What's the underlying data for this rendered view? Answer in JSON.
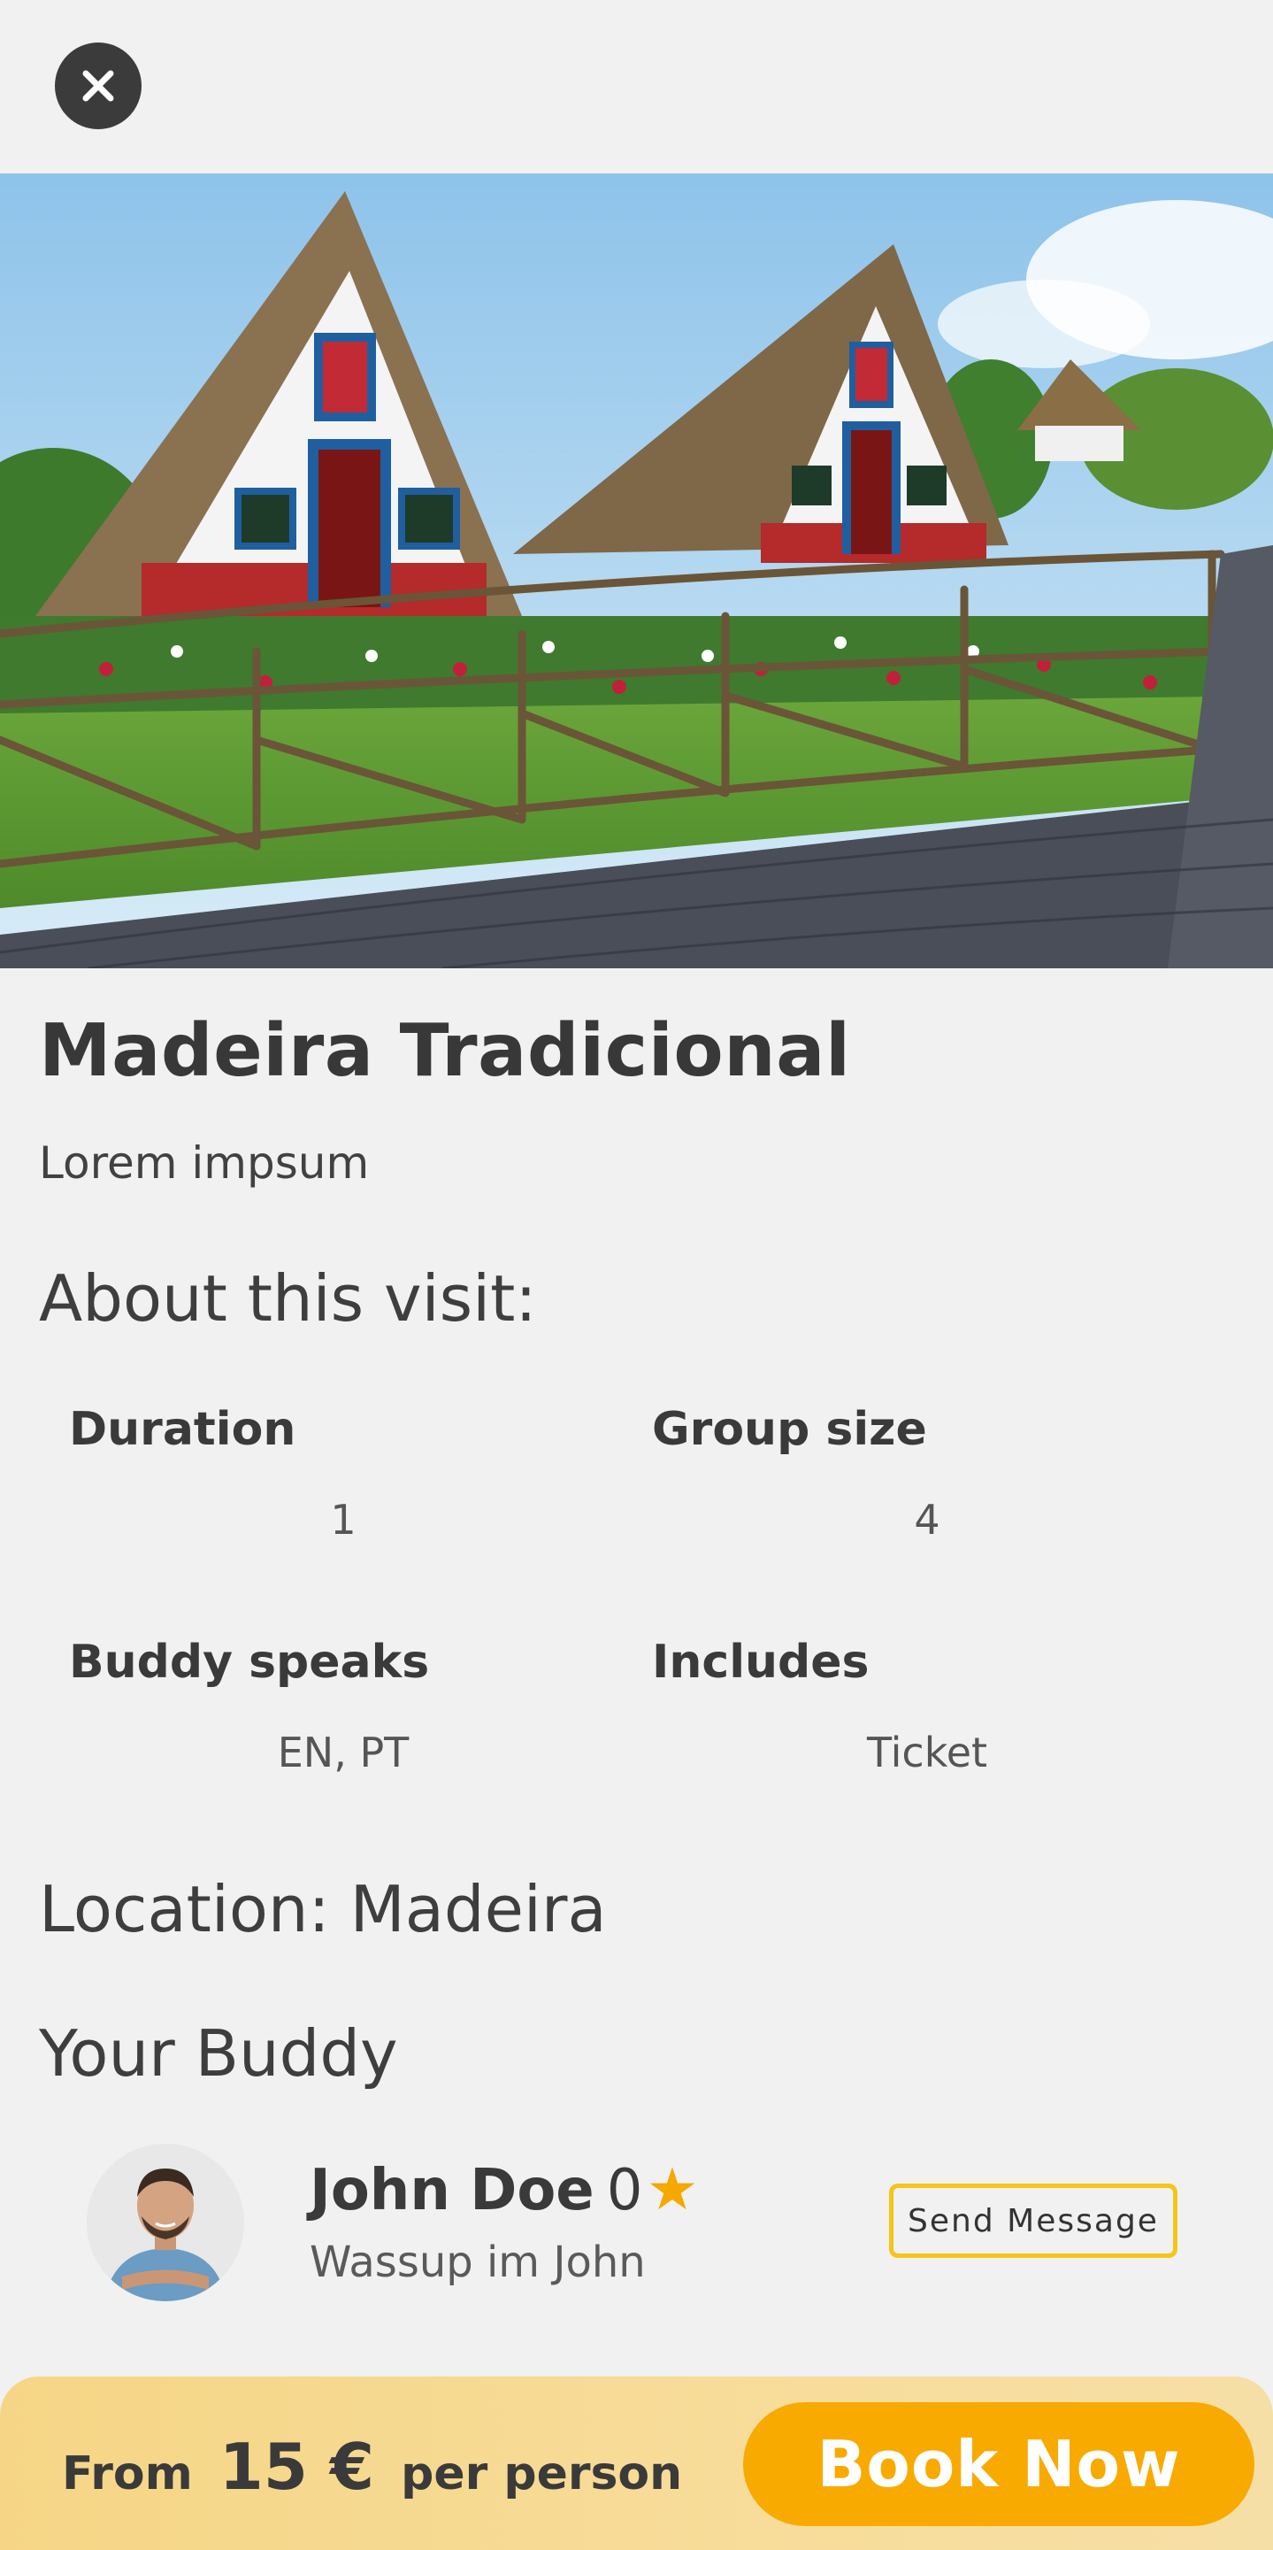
{
  "header": {
    "close_icon": "close-icon"
  },
  "hero": {
    "image_description": ""
  },
  "visit": {
    "title": "Madeira Tradicional",
    "subtitle": "Lorem impsum",
    "about_heading": "About this visit:",
    "details": [
      {
        "label": "Duration",
        "value": "1"
      },
      {
        "label": "Group size",
        "value": "4"
      },
      {
        "label": "Buddy speaks",
        "value": "EN, PT"
      },
      {
        "label": "Includes",
        "value": "Ticket"
      }
    ],
    "location_heading": "Location: Madeira"
  },
  "buddy": {
    "heading": "Your Buddy",
    "name": "John Doe",
    "rating": "0",
    "star_icon": "★",
    "tagline": "Wassup im John",
    "message_button": "Send Message"
  },
  "footer": {
    "from_label": "From",
    "price": "15 €",
    "per_label": "per person",
    "book_button": "Book Now"
  },
  "colors": {
    "accent": "#f8aa00",
    "star": "#f5a800",
    "button_border": "#f5c518",
    "footer_bg": "#f6d686",
    "background": "#f1f1f1"
  }
}
